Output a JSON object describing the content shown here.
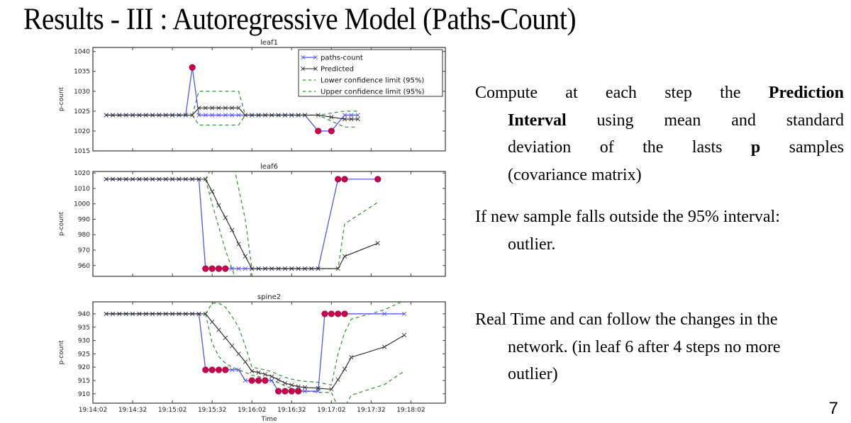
{
  "slide": {
    "title": "Results - III : Autoregressive Model (Paths-Count)",
    "page_number": "7"
  },
  "bullets": [
    {
      "lines": [
        [
          "Compute",
          "at",
          "each",
          "step",
          "the",
          "**Prediction"
        ],
        [
          "**Interval",
          "using",
          "mean",
          "and",
          "standard"
        ],
        [
          "deviation",
          "of",
          "the",
          "lasts",
          "**p",
          "samples"
        ],
        [
          "(covariance matrix)"
        ]
      ]
    },
    {
      "lines": [
        [
          "If new sample falls outside the 95% interval:"
        ],
        [
          "outlier."
        ]
      ]
    },
    {
      "lines": [
        [
          "Real Time and can follow the changes in the"
        ],
        [
          "network. (in leaf 6 after 4 steps no more"
        ],
        [
          "outlier)"
        ]
      ]
    }
  ],
  "colors": {
    "observed": "#5555ee",
    "predicted": "#222222",
    "confidence": "#3a8a3a",
    "outlier": "#cc0044"
  },
  "chart_data": [
    {
      "type": "line",
      "title": "leaf1",
      "xlabel": "",
      "ylabel": "p-count",
      "ylim": [
        1015,
        1041
      ],
      "yticks": [
        1015,
        1020,
        1025,
        1030,
        1035,
        1040
      ],
      "x_unit": "seconds since 19:14:02",
      "xlim": [
        0,
        266
      ],
      "xticks": [
        0,
        30,
        60,
        90,
        120,
        150,
        180,
        210,
        240
      ],
      "xtick_labels": [],
      "grid": false,
      "legend": {
        "placement": "top-right",
        "entries": [
          "paths-count",
          "Predicted",
          "Lower confidence limit (95%)",
          "Upper confidence limit (95%)"
        ]
      },
      "series": [
        {
          "name": "paths-count",
          "x": [
            10,
            15,
            20,
            25,
            30,
            35,
            40,
            45,
            50,
            55,
            60,
            65,
            70,
            75,
            80,
            85,
            90,
            95,
            100,
            105,
            110,
            115,
            120,
            125,
            130,
            135,
            140,
            145,
            150,
            155,
            160,
            170,
            180,
            190,
            195,
            200
          ],
          "y": [
            1024,
            1024,
            1024,
            1024,
            1024,
            1024,
            1024,
            1024,
            1024,
            1024,
            1024,
            1024,
            1024,
            1036,
            1024,
            1024,
            1024,
            1024,
            1024,
            1024,
            1024,
            1024,
            1024,
            1024,
            1024,
            1024,
            1024,
            1024,
            1024,
            1024,
            1024,
            1020,
            1020,
            1024,
            1024,
            1024
          ]
        },
        {
          "name": "Predicted",
          "x": [
            10,
            15,
            20,
            25,
            30,
            35,
            40,
            45,
            50,
            55,
            60,
            65,
            70,
            75,
            80,
            85,
            90,
            95,
            100,
            105,
            110,
            115,
            120,
            125,
            130,
            135,
            140,
            145,
            150,
            155,
            160,
            170,
            180,
            190,
            195,
            200
          ],
          "y": [
            1024,
            1024,
            1024,
            1024,
            1024,
            1024,
            1024,
            1024,
            1024,
            1024,
            1024,
            1024,
            1024,
            1024,
            1025.8,
            1025.8,
            1025.8,
            1025.8,
            1025.8,
            1025.8,
            1025.8,
            1024,
            1024,
            1024,
            1024,
            1024,
            1024,
            1024,
            1024,
            1024,
            1024,
            1024,
            1023.5,
            1023,
            1023,
            1023
          ]
        },
        {
          "name": "Lower confidence limit (95%)",
          "x": [
            75,
            80,
            85,
            90,
            95,
            100,
            105,
            110,
            115,
            120,
            125,
            130,
            135,
            140,
            145,
            150,
            155,
            160,
            170,
            180,
            190,
            195,
            200
          ],
          "y": [
            1024,
            1021.5,
            1021.5,
            1021.5,
            1021.5,
            1021.5,
            1021.5,
            1021.5,
            1024,
            1024,
            1024,
            1024,
            1024,
            1024,
            1024,
            1024,
            1024,
            1024,
            1024,
            1022.5,
            1021,
            1021,
            1021
          ]
        },
        {
          "name": "Upper confidence limit (95%)",
          "x": [
            75,
            80,
            85,
            90,
            95,
            100,
            105,
            110,
            115,
            120,
            125,
            130,
            135,
            140,
            145,
            150,
            155,
            160,
            170,
            180,
            190,
            195,
            200
          ],
          "y": [
            1024,
            1030,
            1030,
            1030,
            1030,
            1030,
            1030,
            1030,
            1024,
            1024,
            1024,
            1024,
            1024,
            1024,
            1024,
            1024,
            1024,
            1024,
            1024,
            1024.5,
            1025,
            1025,
            1025
          ]
        },
        {
          "name": "outliers",
          "x": [
            75,
            170,
            180
          ],
          "y": [
            1036,
            1020,
            1020
          ]
        }
      ]
    },
    {
      "type": "line",
      "title": "leaf6",
      "xlabel": "",
      "ylabel": "p-count",
      "ylim": [
        953,
        1021
      ],
      "yticks": [
        960,
        970,
        980,
        990,
        1000,
        1010,
        1020
      ],
      "x_unit": "seconds since 19:14:02",
      "xlim": [
        0,
        266
      ],
      "xticks": [
        0,
        30,
        60,
        90,
        120,
        150,
        180,
        210,
        240
      ],
      "xtick_labels": [],
      "grid": false,
      "series": [
        {
          "name": "paths-count",
          "x": [
            10,
            15,
            20,
            25,
            30,
            35,
            40,
            45,
            50,
            55,
            60,
            65,
            70,
            75,
            80,
            85,
            90,
            95,
            100,
            105,
            110,
            115,
            120,
            125,
            130,
            135,
            140,
            145,
            150,
            155,
            160,
            165,
            170,
            185,
            190,
            215
          ],
          "y": [
            1016,
            1016,
            1016,
            1016,
            1016,
            1016,
            1016,
            1016,
            1016,
            1016,
            1016,
            1016,
            1016,
            1016,
            1016,
            958,
            958,
            958,
            958,
            958,
            958,
            958,
            958,
            958,
            958,
            958,
            958,
            958,
            958,
            958,
            958,
            958,
            958,
            1016,
            1016,
            1016
          ]
        },
        {
          "name": "Predicted",
          "x": [
            10,
            15,
            20,
            25,
            30,
            35,
            40,
            45,
            50,
            55,
            60,
            65,
            70,
            75,
            80,
            85,
            90,
            95,
            100,
            105,
            110,
            115,
            120,
            125,
            130,
            135,
            140,
            145,
            150,
            155,
            160,
            165,
            170,
            185,
            190,
            215
          ],
          "y": [
            1016,
            1016,
            1016,
            1016,
            1016,
            1016,
            1016,
            1016,
            1016,
            1016,
            1016,
            1016,
            1016,
            1016,
            1016,
            1016,
            1008,
            999,
            991,
            983,
            974,
            966,
            958,
            958,
            958,
            958,
            958,
            958,
            958,
            958,
            958,
            958,
            958,
            958,
            966,
            974.5
          ]
        },
        {
          "name": "Lower confidence limit (95%)",
          "x": [
            85,
            90,
            95,
            100,
            105,
            110,
            115,
            120,
            125,
            130,
            135,
            140,
            145,
            150,
            155,
            160,
            165,
            170,
            185
          ],
          "y": [
            1016,
            1000,
            985,
            970,
            958,
            945,
            935,
            958,
            958,
            958,
            958,
            958,
            958,
            958,
            958,
            958,
            958,
            958,
            958
          ]
        },
        {
          "name": "Upper confidence limit (95%)",
          "x": [
            85,
            100,
            105,
            110,
            115,
            120,
            125,
            130,
            135,
            140,
            145,
            150,
            155,
            160,
            165,
            170,
            185,
            190,
            215
          ],
          "y": [
            1016,
            1040,
            1030,
            1010,
            990,
            958,
            958,
            958,
            958,
            958,
            958,
            958,
            958,
            958,
            958,
            958,
            958,
            987,
            1001
          ]
        },
        {
          "name": "outliers",
          "x": [
            85,
            90,
            95,
            100,
            185,
            190,
            215
          ],
          "y": [
            958,
            958,
            958,
            958,
            1016,
            1016,
            1016
          ]
        }
      ]
    },
    {
      "type": "line",
      "title": "spine2",
      "xlabel": "Time",
      "ylabel": "p-count",
      "ylim": [
        906.5,
        944.5
      ],
      "yticks": [
        910,
        915,
        920,
        925,
        930,
        935,
        940
      ],
      "x_unit": "seconds since 19:14:02",
      "xlim": [
        0,
        266
      ],
      "xticks": [
        0,
        30,
        60,
        90,
        120,
        150,
        180,
        210,
        240
      ],
      "xtick_labels": [
        "19:14:02",
        "19:14:32",
        "19:15:02",
        "19:15:32",
        "19:16:02",
        "19:16:32",
        "19:17:02",
        "19:17:32",
        "19:18:02"
      ],
      "grid": false,
      "series": [
        {
          "name": "paths-count",
          "x": [
            10,
            15,
            20,
            25,
            30,
            35,
            40,
            45,
            50,
            55,
            60,
            65,
            70,
            75,
            80,
            85,
            90,
            95,
            100,
            105,
            110,
            115,
            120,
            125,
            130,
            135,
            140,
            145,
            150,
            155,
            160,
            170,
            175,
            180,
            185,
            190,
            220,
            235
          ],
          "y": [
            940,
            940,
            940,
            940,
            940,
            940,
            940,
            940,
            940,
            940,
            940,
            940,
            940,
            940,
            940,
            919,
            919,
            919,
            919,
            919,
            919,
            915,
            915,
            915,
            915,
            915,
            911,
            911,
            911,
            911,
            911,
            911,
            940,
            940,
            940,
            940,
            940,
            940
          ]
        },
        {
          "name": "Predicted",
          "x": [
            10,
            15,
            20,
            25,
            30,
            35,
            40,
            45,
            50,
            55,
            60,
            65,
            70,
            75,
            80,
            85,
            90,
            95,
            100,
            105,
            110,
            115,
            120,
            125,
            130,
            135,
            140,
            145,
            150,
            155,
            160,
            170,
            180,
            185,
            190,
            195,
            220,
            235
          ],
          "y": [
            940,
            940,
            940,
            940,
            940,
            940,
            940,
            940,
            940,
            940,
            940,
            940,
            940,
            940,
            940,
            940,
            937,
            934,
            931,
            928,
            925,
            922,
            918.5,
            918,
            917.3,
            916.5,
            915.3,
            914,
            913.3,
            912.7,
            912.4,
            912.1,
            911.7,
            915.3,
            919.3,
            923.7,
            927.6,
            932
          ]
        },
        {
          "name": "Lower confidence limit (95%)",
          "x": [
            85,
            90,
            95,
            100,
            105,
            110,
            115,
            120,
            125,
            130,
            135,
            140,
            145,
            150,
            155,
            160,
            170,
            180,
            185,
            190,
            195,
            220,
            235
          ],
          "y": [
            940,
            929,
            924,
            921.5,
            920,
            919,
            918,
            917,
            916.5,
            915.8,
            915,
            914.2,
            913,
            912,
            911.3,
            911,
            910.6,
            910.5,
            905,
            905,
            909.5,
            913.5,
            918.5
          ]
        },
        {
          "name": "Upper confidence limit (95%)",
          "x": [
            85,
            90,
            95,
            100,
            105,
            110,
            115,
            120,
            125,
            130,
            135,
            140,
            145,
            150,
            155,
            160,
            170,
            180,
            185,
            190,
            195,
            220,
            235
          ],
          "y": [
            940,
            944,
            944,
            942.5,
            939,
            935,
            928,
            920,
            919.5,
            919,
            918.3,
            917.2,
            916.2,
            915.5,
            915,
            914.7,
            914.3,
            913.3,
            925,
            933,
            938,
            941.5,
            945
          ]
        },
        {
          "name": "outliers",
          "x": [
            85,
            90,
            95,
            100,
            120,
            125,
            130,
            140,
            145,
            150,
            155,
            175,
            180,
            185,
            190
          ],
          "y": [
            919,
            919,
            919,
            919,
            915,
            915,
            915,
            911,
            911,
            911,
            911,
            940,
            940,
            940,
            940
          ]
        }
      ]
    }
  ]
}
